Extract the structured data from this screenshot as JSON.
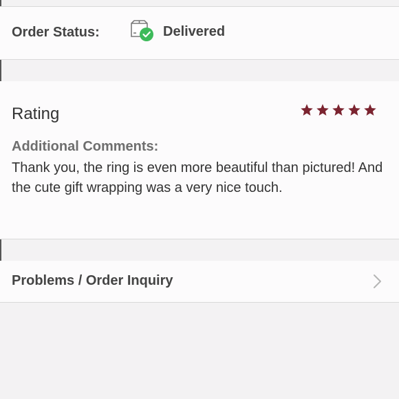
{
  "order_status": {
    "label": "Order Status:",
    "value": "Delivered",
    "icon": "delivered-box-icon",
    "check_color": "#3dba5a"
  },
  "review": {
    "rating_title": "Rating",
    "rating": 5,
    "rating_max": 5,
    "star_color": "#7b2430",
    "comments_label": "Additional Comments:",
    "comments_text": "Thank you, the ring is even more beautiful than pictured! And the cute gift wrapping was a very nice touch."
  },
  "inquiry": {
    "label": "Problems / Order Inquiry",
    "icon": "chevron-right-icon"
  }
}
